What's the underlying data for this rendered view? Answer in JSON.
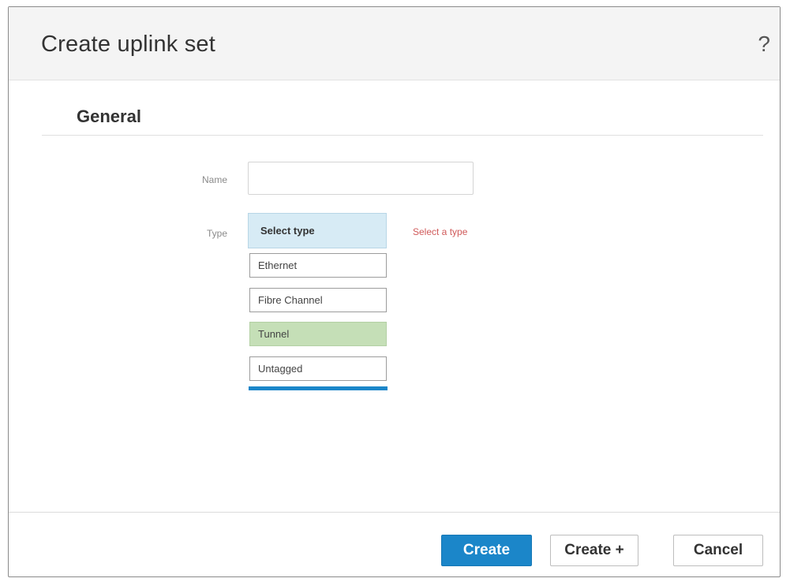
{
  "dialog": {
    "title": "Create uplink set",
    "help_glyph": "?"
  },
  "section": {
    "title": "General"
  },
  "form": {
    "name": {
      "label": "Name",
      "value": "",
      "placeholder": ""
    },
    "type": {
      "label": "Type",
      "selected": "Select type",
      "validation": "Select a type",
      "options": [
        "Ethernet",
        "Fibre Channel",
        "Tunnel",
        "Untagged"
      ],
      "highlighted_option": "Tunnel"
    }
  },
  "buttons": {
    "create": "Create",
    "create_plus": "Create +",
    "cancel": "Cancel"
  },
  "colors": {
    "primary": "#1b86c9",
    "error": "#d05a5a",
    "select_bg": "#d7ebf5",
    "highlight_bg": "#c5dfb7"
  },
  "icons": {
    "help": "help-icon"
  }
}
